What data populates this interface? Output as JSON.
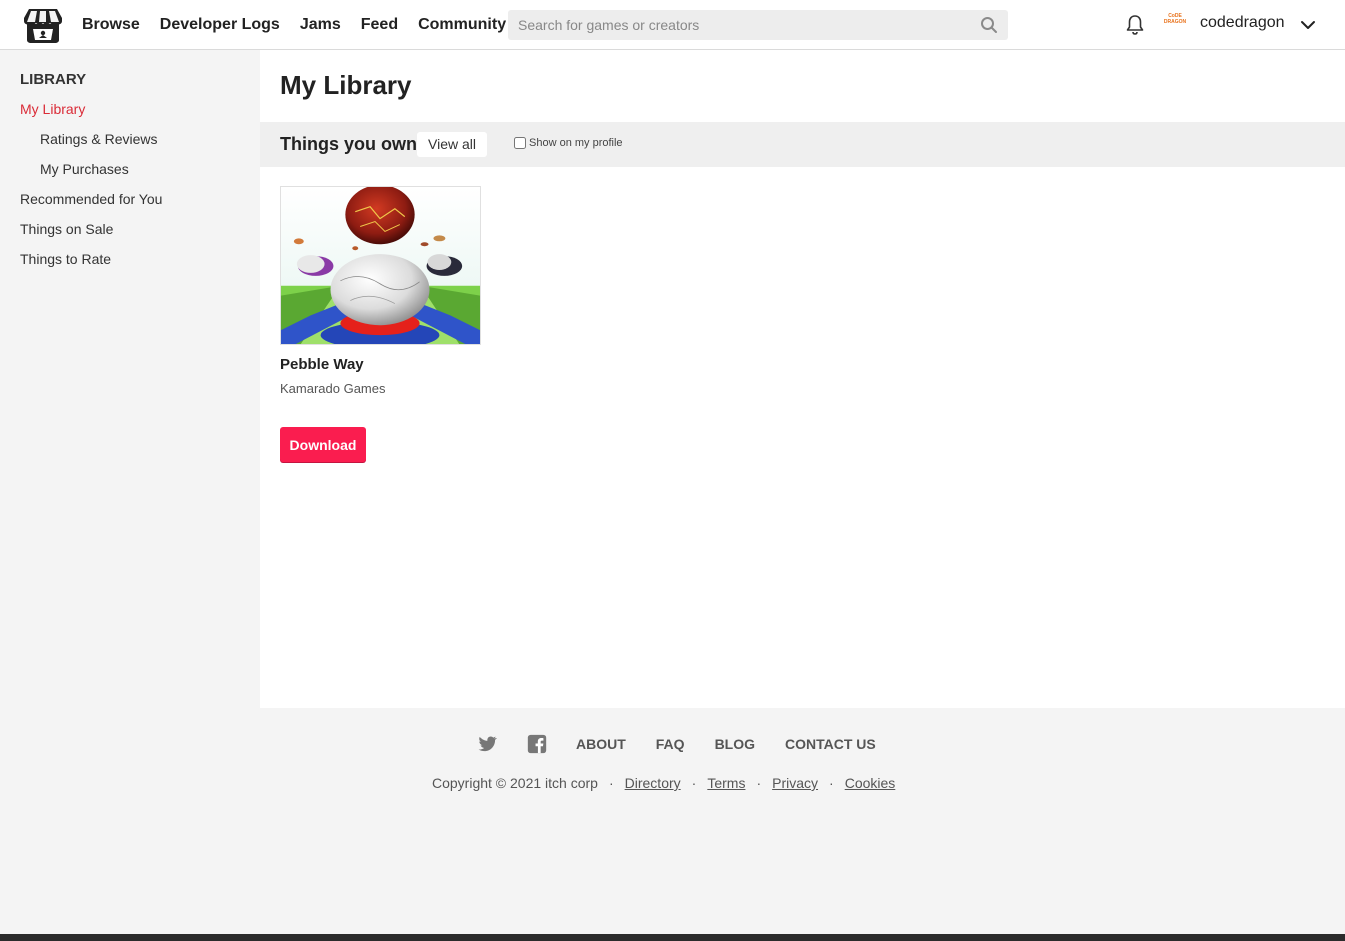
{
  "header": {
    "logo_icon": "itch-logo-icon",
    "nav": [
      "Browse",
      "Developer Logs",
      "Jams",
      "Feed",
      "Community"
    ],
    "search": {
      "placeholder": "Search for games or creators",
      "value": "",
      "icon": "search-icon"
    },
    "notifications_icon": "bell-icon",
    "avatar_text": "CoDE DRAGON",
    "username": "codedragon",
    "menu_icon": "chevron-down-icon"
  },
  "sidebar": {
    "heading": "LIBRARY",
    "items": [
      {
        "label": "My Library",
        "active": true
      },
      {
        "label": "Ratings & Reviews",
        "active": false
      },
      {
        "label": "My Purchases",
        "active": false
      },
      {
        "label": "Recommended for You",
        "active": false
      },
      {
        "label": "Things on Sale",
        "active": false
      },
      {
        "label": "Things to Rate",
        "active": false
      }
    ]
  },
  "main": {
    "title": "My Library",
    "section": {
      "title": "Things you own",
      "view_all": "View all",
      "show_on_profile": {
        "label": "Show on my profile",
        "checked": false
      }
    },
    "games": [
      {
        "title": "Pebble Way",
        "author": "Kamarado Games",
        "action": "Download"
      }
    ]
  },
  "footer": {
    "social_icons": [
      "twitter-icon",
      "facebook-icon"
    ],
    "links": [
      "ABOUT",
      "FAQ",
      "BLOG",
      "CONTACT US"
    ],
    "copyright": "Copyright © 2021 itch corp",
    "legal_links": [
      "Directory",
      "Terms",
      "Privacy",
      "Cookies"
    ]
  },
  "colors": {
    "accent": "#da2c38",
    "download_button": "#fa1d4f",
    "sidebar_bg": "#f4f4f4",
    "content_bg": "#ffffff"
  }
}
